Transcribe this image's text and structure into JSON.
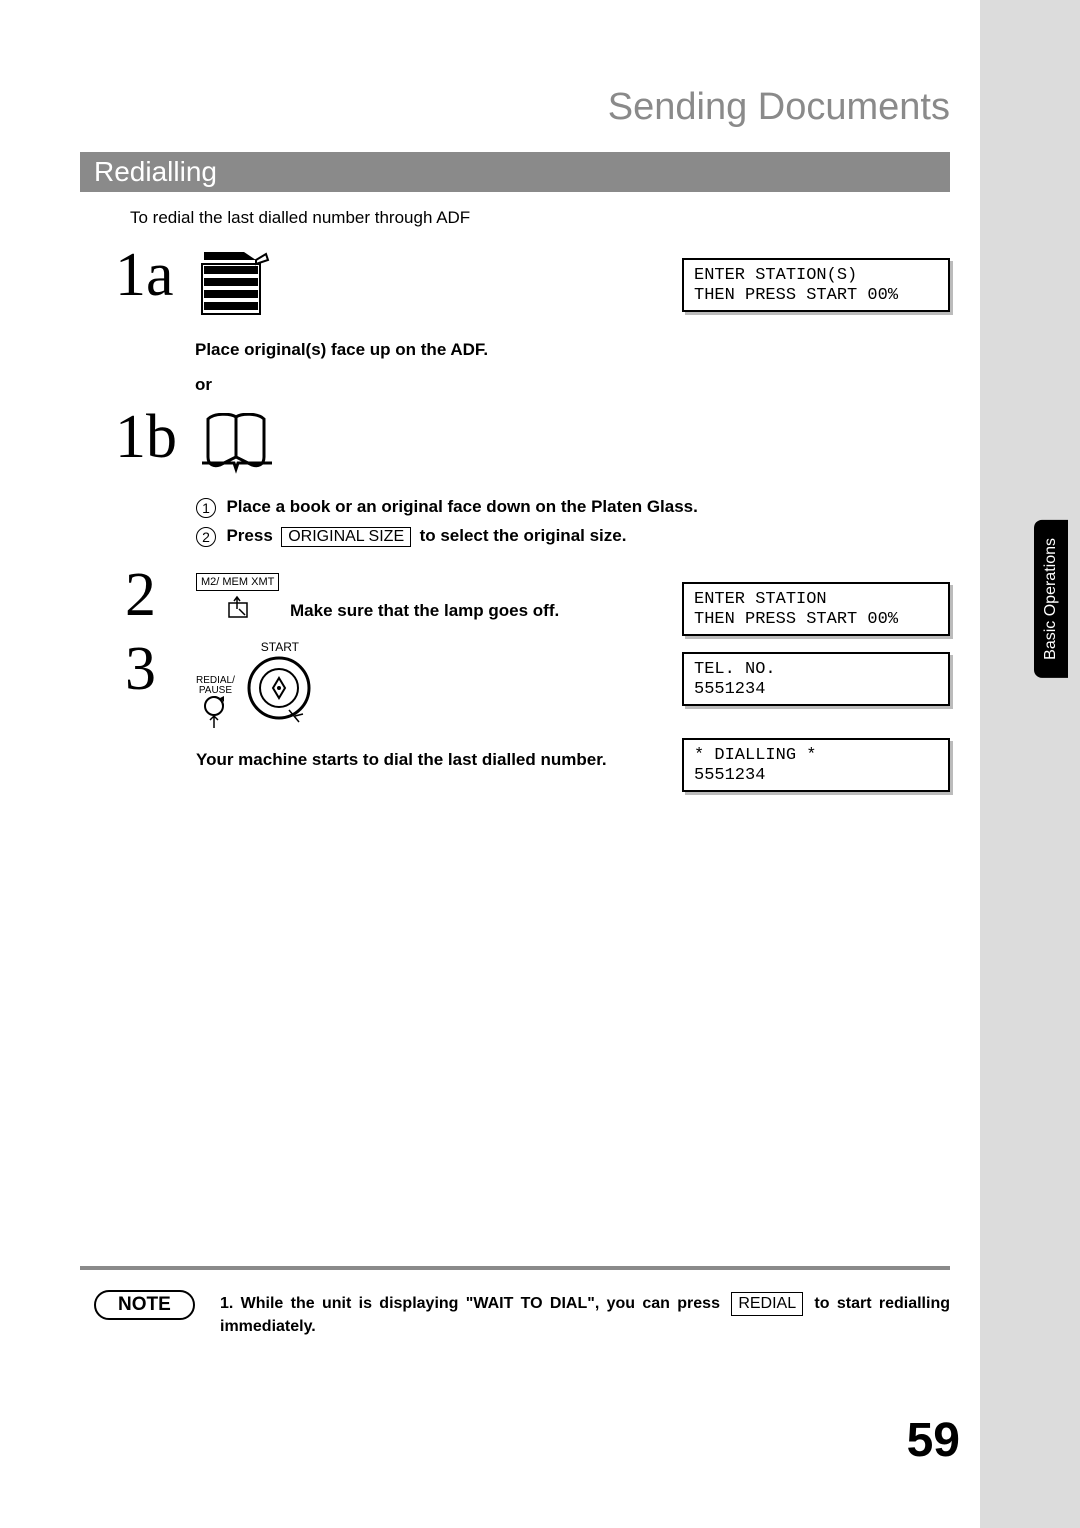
{
  "header": {
    "title": "Sending Documents",
    "section": "Redialling",
    "side_tab": "Basic Operations"
  },
  "intro": "To redial the last dialled number through ADF",
  "steps": {
    "s1a": {
      "num": "1a",
      "caption": "Place original(s) face up on the ADF.",
      "or": "or"
    },
    "s1b": {
      "num": "1b",
      "sub1_num": "1",
      "sub1_text": "Place a book or an original face down on the Platen Glass.",
      "sub2_num": "2",
      "sub2_pre": "Press",
      "sub2_key": "ORIGINAL  SIZE",
      "sub2_post": " to select the original size."
    },
    "s2": {
      "num": "2",
      "mem_label": "M2/  MEM XMT",
      "text": "Make sure that the lamp goes off."
    },
    "s3": {
      "num": "3",
      "start_label": "START",
      "redial_label1": "REDIAL/",
      "redial_label2": "PAUSE",
      "text": "Your machine starts to dial the last dialled number."
    }
  },
  "lcd": {
    "d1": "ENTER STATION(S)\nTHEN PRESS START 00%",
    "d2": "ENTER STATION\nTHEN PRESS START 00%",
    "d3": "TEL. NO.\n5551234",
    "d4": "* DIALLING *\n5551234"
  },
  "note": {
    "badge": "NOTE",
    "n1_pre": "1. While the unit is displaying \"WAIT TO DIAL\", you can press ",
    "n1_key": "REDIAL",
    "n1_post": " to start redialling immediately."
  },
  "page_number": "59"
}
